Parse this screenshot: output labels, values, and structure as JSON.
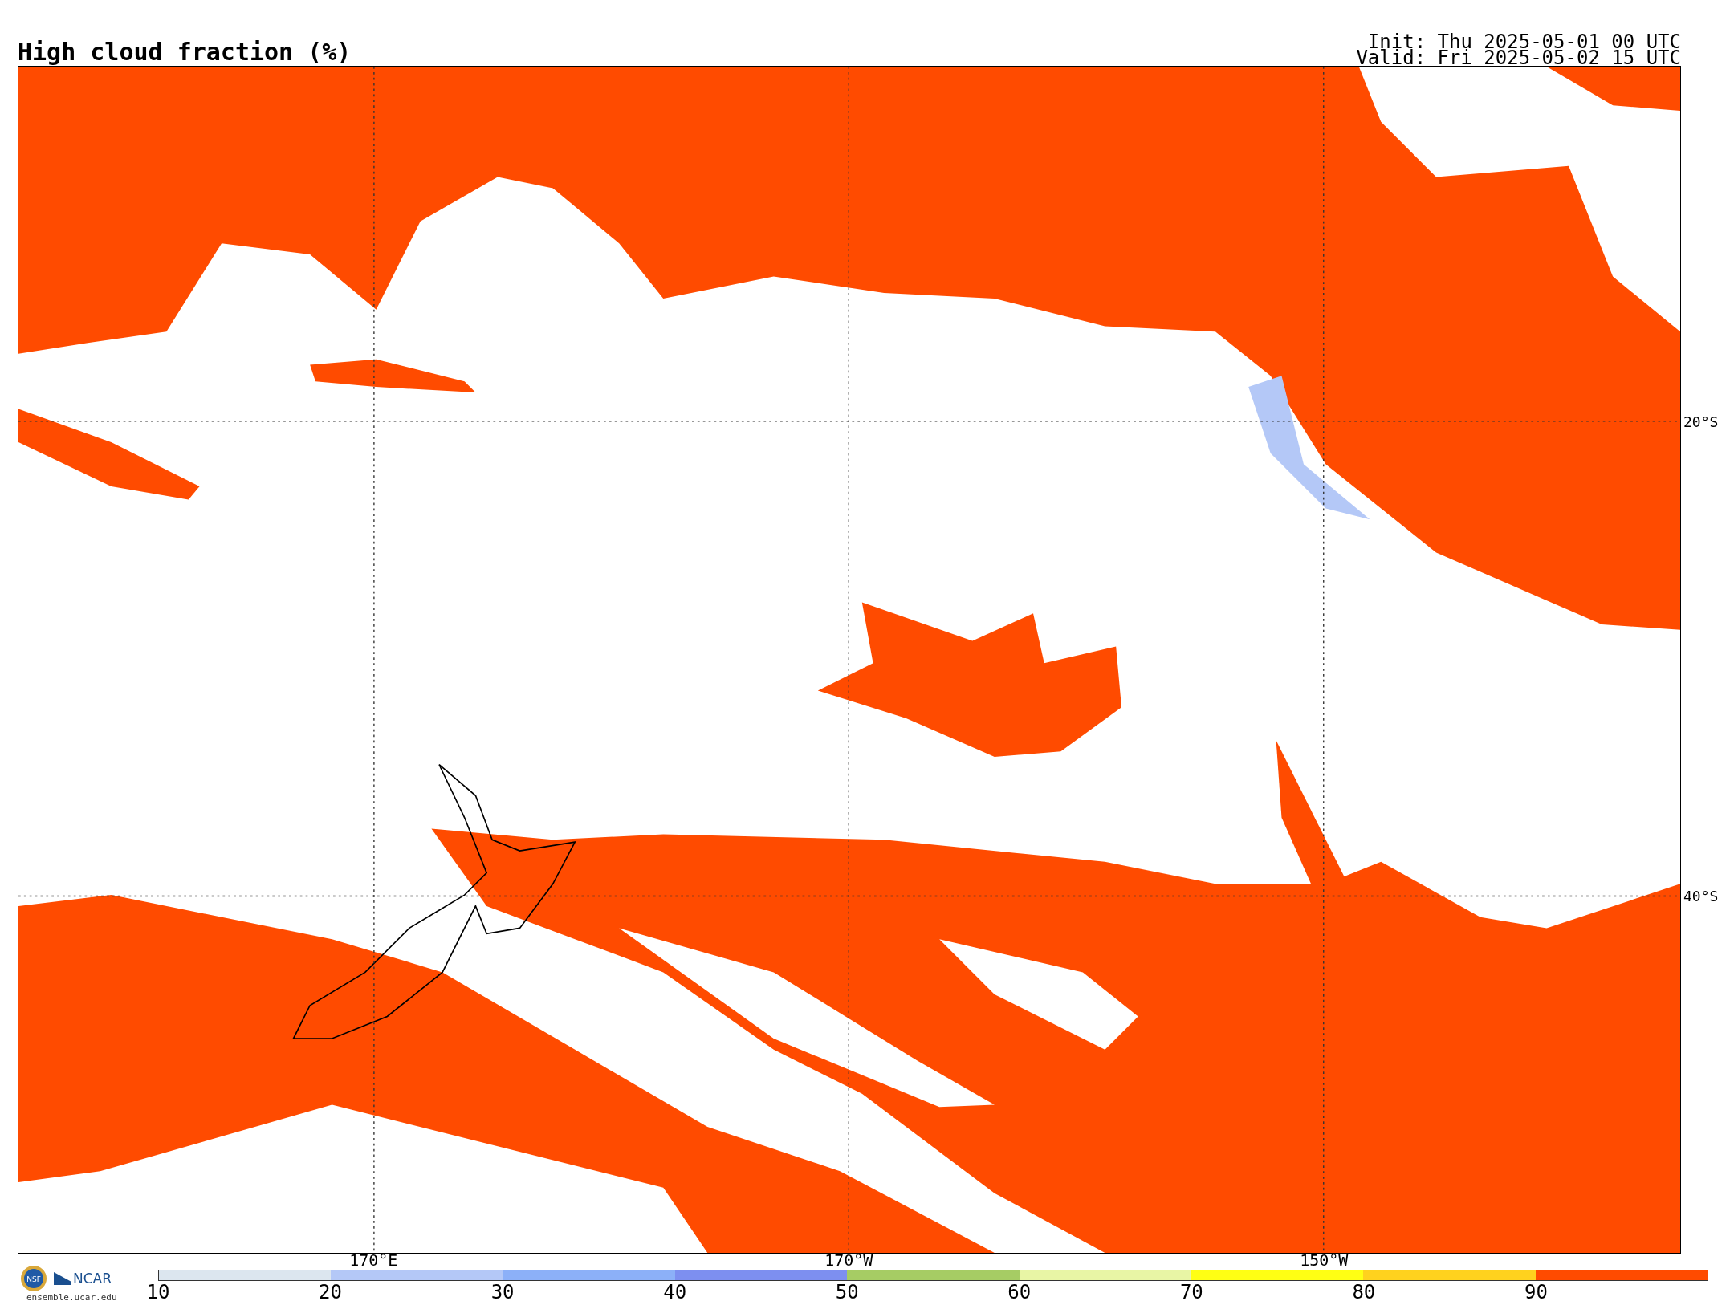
{
  "title": "High cloud fraction (%)",
  "run_info": [
    "Init: Thu 2025-05-01 00 UTC",
    "Valid: Fri 2025-05-02 15 UTC"
  ],
  "map": {
    "lat_labels": [
      "20°S",
      "40°S"
    ],
    "lon_labels": [
      "170°E",
      "170°W",
      "150°W"
    ]
  },
  "logos": {
    "seal": "NSF",
    "org": "NCAR",
    "site": "ensemble.ucar.edu"
  },
  "colorbar": {
    "segments": [
      {
        "color": "#dce6ef"
      },
      {
        "color": "#b4c8f7"
      },
      {
        "color": "#8cb0f8"
      },
      {
        "color": "#7d8ff0"
      },
      {
        "color": "#a6cc64"
      },
      {
        "color": "#e8f5a5"
      },
      {
        "color": "#ffff14"
      },
      {
        "color": "#ffd21e"
      },
      {
        "color": "#ff4b00"
      }
    ],
    "ticks": [
      "10",
      "20",
      "30",
      "40",
      "50",
      "60",
      "70",
      "80",
      "90"
    ]
  }
}
